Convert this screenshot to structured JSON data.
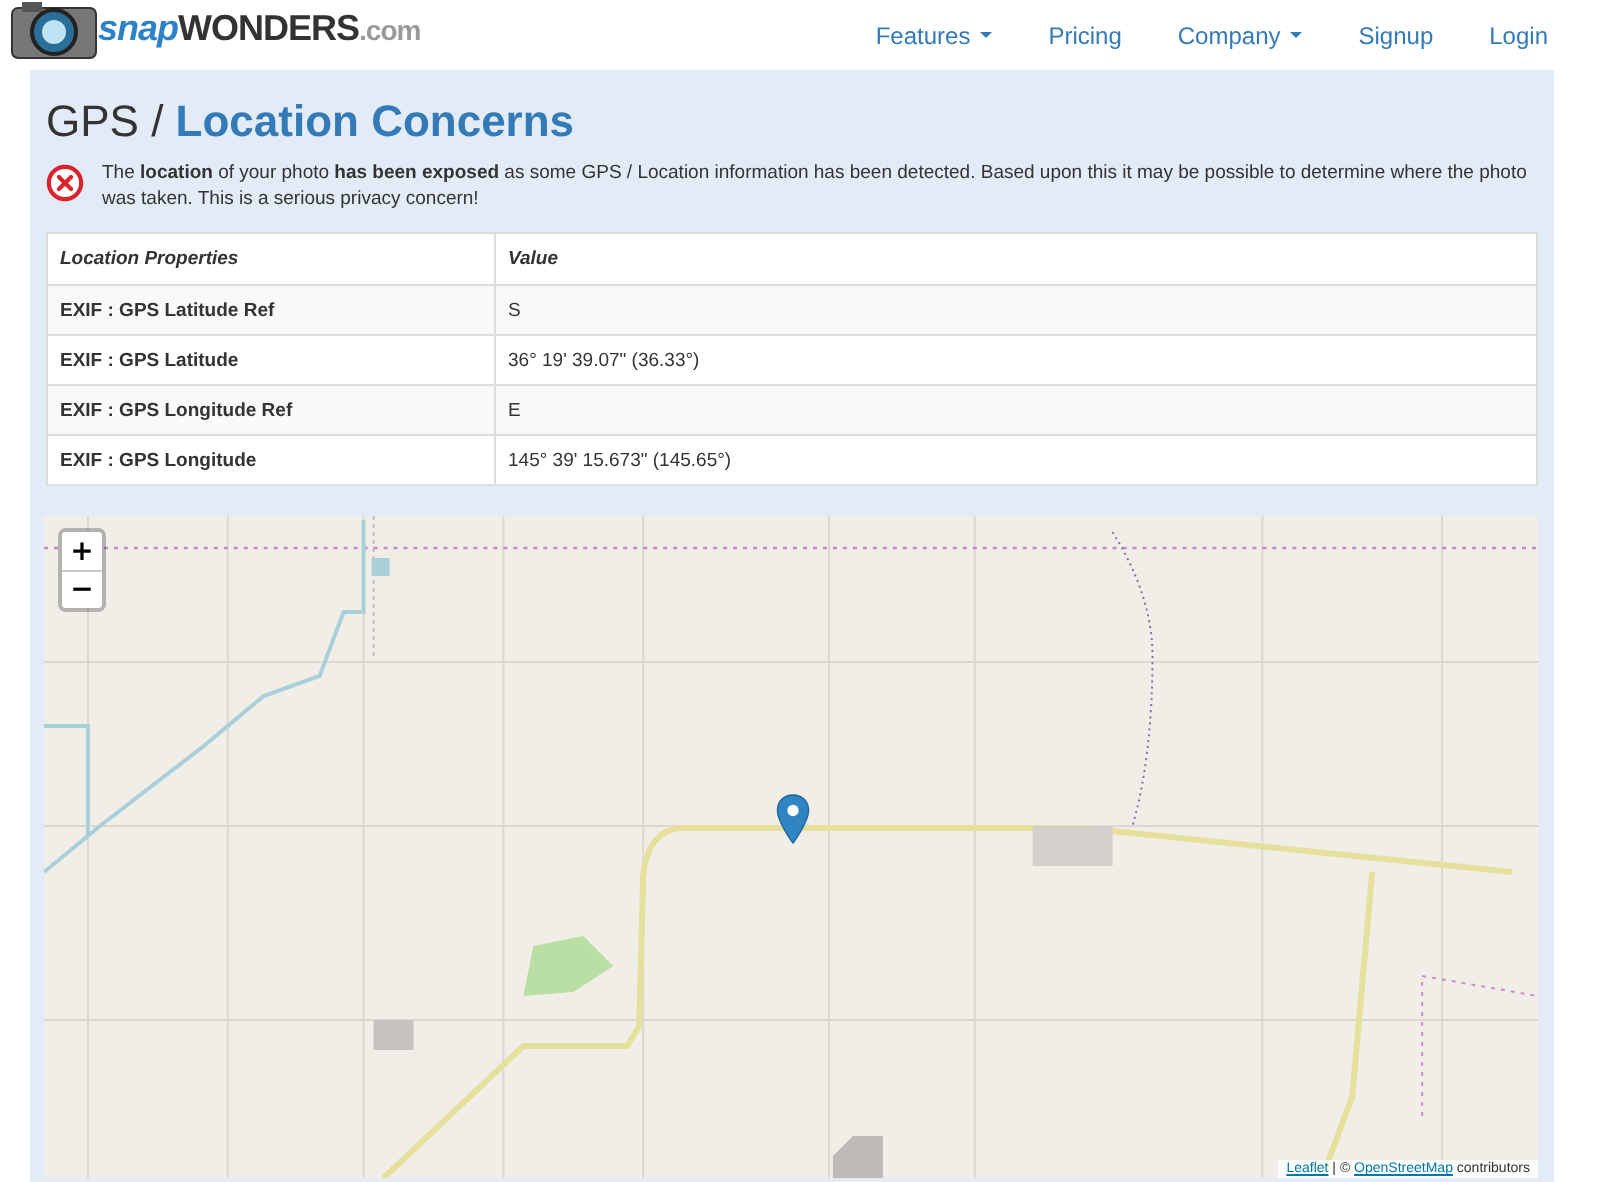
{
  "logo_text": [
    "snap",
    "WONDERS",
    ".com"
  ],
  "nav": [
    {
      "label": "Features",
      "dropdown": true
    },
    {
      "label": "Pricing",
      "dropdown": false
    },
    {
      "label": "Company",
      "dropdown": true
    },
    {
      "label": "Signup",
      "dropdown": false
    },
    {
      "label": "Login",
      "dropdown": false
    }
  ],
  "heading": {
    "prefix": "GPS / ",
    "main": "Location Concerns"
  },
  "alert": "The **location** of your photo **has been exposed** as some GPS / Location information has been detected. Based upon this it may be possible to determine where the photo was taken. This is a serious privacy concern!",
  "table": {
    "columns": [
      "Location Properties",
      "Value"
    ],
    "rows": [
      [
        "EXIF : GPS Latitude Ref",
        "S"
      ],
      [
        "EXIF : GPS Latitude",
        "36° 19' 39.07\" (36.33°)"
      ],
      [
        "EXIF : GPS Longitude Ref",
        "E"
      ],
      [
        "EXIF : GPS Longitude",
        "145° 39' 15.673\" (145.65°)"
      ]
    ]
  },
  "map": {
    "zoom_in": "+",
    "zoom_out": "−",
    "attribution": {
      "link1": "Leaflet",
      "separator": " | © ",
      "link2": "OpenStreetMap",
      "suffix": " contributors"
    }
  }
}
